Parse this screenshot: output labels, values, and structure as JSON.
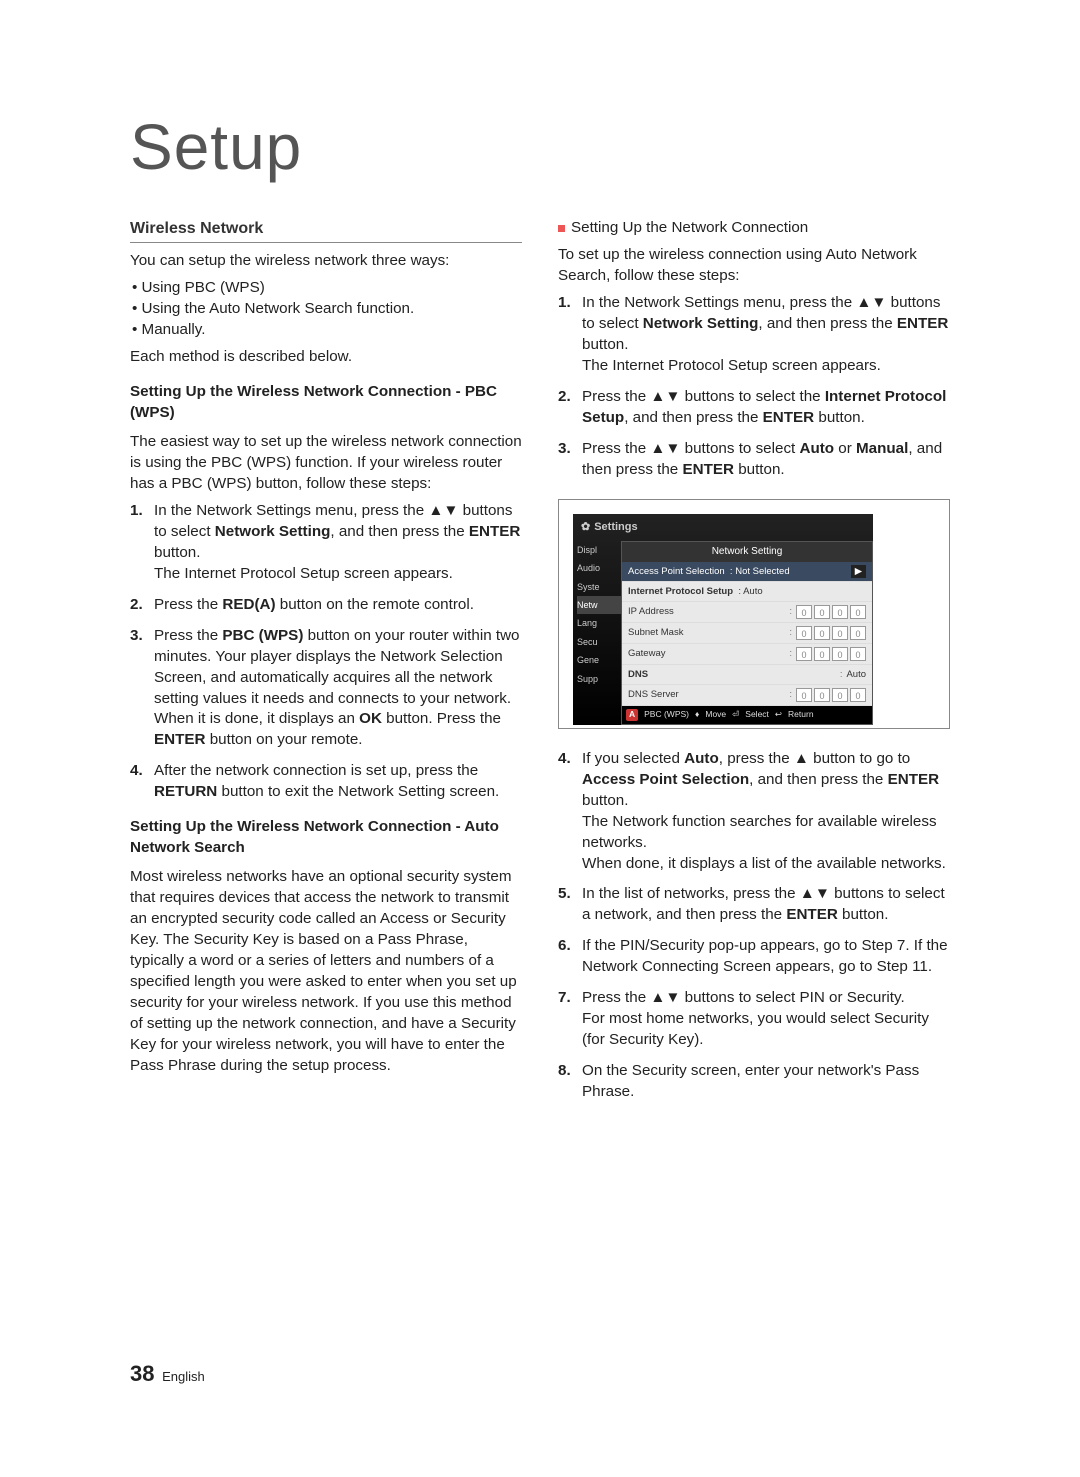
{
  "title": "Setup",
  "left": {
    "heading": "Wireless Network",
    "intro": "You can setup the wireless network three ways:",
    "bullets": [
      "Using PBC (WPS)",
      "Using the Auto Network Search function.",
      "Manually."
    ],
    "intro_after": "Each method is described below.",
    "sec1_title": "Setting Up the Wireless Network Connection - PBC (WPS)",
    "sec1_intro": "The easiest way to set up the wireless network connection is using the PBC (WPS) function. If your wireless router has a PBC (WPS) button, follow these steps:",
    "sec1_steps": [
      {
        "n": "1.",
        "pre": "In the Network Settings menu, press the ▲▼ buttons to select ",
        "b": "Network Setting",
        "post": ", and then press the ",
        "b2": "ENTER",
        "post2": " button.",
        "line2": "The Internet Protocol Setup screen appears."
      },
      {
        "n": "2.",
        "pre": "Press the ",
        "b": "RED(A)",
        "post": " button on the remote control."
      },
      {
        "n": "3.",
        "pre": "Press the ",
        "b": "PBC (WPS)",
        "post": " button on your router within two minutes. Your player displays the Network Selection Screen, and automatically acquires all the network setting values it needs and connects to your network. When it is done, it displays an ",
        "b2": "OK",
        "post2": " button. Press the ",
        "b3": "ENTER",
        "post3": " button on your remote."
      },
      {
        "n": "4.",
        "pre": "After the network connection is set up, press the ",
        "b": "RETURN",
        "post": " button to exit the Network Setting screen."
      }
    ],
    "sec2_title": "Setting Up the Wireless Network Connection - Auto Network Search",
    "sec2_body": "Most wireless networks have an optional security system that requires devices that access the network to transmit an encrypted security code called an Access or Security Key. The Security Key is based on a Pass Phrase, typically a word or a series of letters and numbers of a specified length you were asked to enter when you set up security for your wireless network. If you use this method of setting up the network connection, and have a Security Key for your wireless network, you will have to enter the Pass Phrase during the setup process."
  },
  "right": {
    "square_heading": "Setting Up the Network Connection",
    "intro": "To set up the wireless connection using Auto Network Search, follow these steps:",
    "steps_a": [
      {
        "n": "1.",
        "pre": "In the Network Settings menu, press the ▲▼ buttons to select ",
        "b": "Network Setting",
        "post": ", and then press the ",
        "b2": "ENTER",
        "post2": " button.",
        "line2": "The Internet Protocol Setup screen appears."
      },
      {
        "n": "2.",
        "pre": "Press the ▲▼ buttons to select the ",
        "b": "Internet Protocol Setup",
        "post": ", and then press the ",
        "b2": "ENTER",
        "post2": " button."
      },
      {
        "n": "3.",
        "pre": "Press the ▲▼ buttons to select ",
        "b": "Auto",
        "post": " or ",
        "b2": "Manual",
        "post2": ", and then press the ",
        "b3": "ENTER",
        "post3": " button."
      }
    ],
    "steps_b": [
      {
        "n": "4.",
        "pre": "If you selected ",
        "b": "Auto",
        "post": ", press the ▲ button to go to ",
        "b2": "Access Point Selection",
        "post2": ", and then press the ",
        "b3": "ENTER",
        "post3": " button.",
        "line2": "The Network function searches for available wireless networks.",
        "line3": "When done, it displays a list of the available networks."
      },
      {
        "n": "5.",
        "pre": "In the list of networks, press the ▲▼ buttons to select a network, and then press the ",
        "b": "ENTER",
        "post": " button."
      },
      {
        "n": "6.",
        "pre": "If the PIN/Security pop-up appears, go to Step 7. If the Network Connecting Screen appears, go to Step 11."
      },
      {
        "n": "7.",
        "pre": "Press the ▲▼ buttons to select PIN or Security.",
        "line2": "For most home networks, you would select Security (for Security Key)."
      },
      {
        "n": "8.",
        "pre": "On the Security screen, enter your network's Pass Phrase."
      }
    ]
  },
  "settings": {
    "title": "Settings",
    "panel_title": "Network Setting",
    "sidebar": [
      "Displ",
      "Audio",
      "Syste",
      "Netw",
      "Lang",
      "Secu",
      "Gene",
      "Supp"
    ],
    "rows": {
      "aps_label": "Access Point Selection",
      "aps_val": "Not Selected",
      "ips_label": "Internet Protocol Setup",
      "ips_val": "Auto",
      "ip": "IP Address",
      "sm": "Subnet Mask",
      "gw": "Gateway",
      "dns": "DNS",
      "dns_val": "Auto",
      "dnss": "DNS Server"
    },
    "footer": {
      "a": "A",
      "pbc": "PBC (WPS)",
      "move": "Move",
      "select": "Select",
      "ret": "Return"
    }
  },
  "footer": {
    "page": "38",
    "lang": "English"
  }
}
